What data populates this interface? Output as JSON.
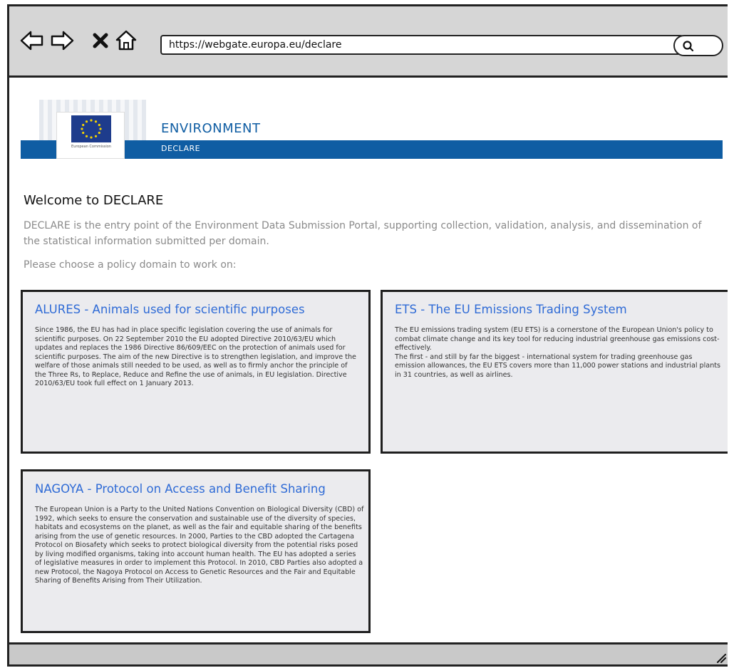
{
  "browser": {
    "url": "https://webgate.europa.eu/declare",
    "icons": {
      "back": "back-arrow-icon",
      "forward": "forward-arrow-icon",
      "stop": "close-icon",
      "home": "home-icon",
      "search": "search-icon"
    }
  },
  "header": {
    "title": "ENVIRONMENT",
    "subtitle": "DECLARE",
    "logo_text": "European Commission",
    "brand_color": "#0f5da3"
  },
  "main": {
    "welcome": "Welcome to DECLARE",
    "intro": "DECLARE is the entry point of the Environment Data Submission Portal, supporting collection, validation, analysis, and dissemination of the statistical information submitted per domain.",
    "choose": "Please choose a policy domain to work on:"
  },
  "domains": [
    {
      "title": "ALURES - Animals used for scientific purposes",
      "description": "Since 1986, the EU has had in place specific legislation covering the use of animals for scientific purposes. On 22 September 2010 the EU adopted Directive 2010/63/EU which updates and replaces the 1986 Directive 86/609/EEC on the protection of animals used for scientific purposes. The aim of the new Directive is to strengthen legislation, and improve the welfare of those animals still needed to be used, as well as to firmly anchor the principle of the Three Rs, to Replace, Reduce and Refine the use of animals, in EU legislation. Directive 2010/63/EU took full effect on 1 January 2013."
    },
    {
      "title": "ETS - The EU Emissions Trading System",
      "description": "The EU emissions trading system (EU ETS) is a cornerstone of the European Union's policy to combat climate change and its key tool for reducing industrial greenhouse gas emissions cost-effectively.\nThe first - and still by far the biggest - international system for trading greenhouse gas emission allowances, the EU ETS covers more than 11,000 power stations and industrial plants in 31 countries, as well as airlines."
    },
    {
      "title": "NAGOYA - Protocol on Access and Benefit Sharing",
      "description": "The European Union is a Party to the United Nations Convention on Biological Diversity (CBD) of 1992, which seeks to ensure the conservation and sustainable use of the diversity of species, habitats and ecosystems on the planet, as well as the fair and equitable sharing of the benefits arising from the use of genetic resources. In 2000, Parties to the CBD adopted the Cartagena Protocol on Biosafety which seeks to protect biological diversity from the potential risks posed by living modified organisms, taking into account human health. The EU has adopted a series of legislative measures in order to implement this Protocol. In 2010, CBD Parties also adopted a new Protocol, the Nagoya Protocol on Access to Genetic Resources and the Fair and Equitable Sharing of Benefits Arising from Their Utilization."
    }
  ]
}
